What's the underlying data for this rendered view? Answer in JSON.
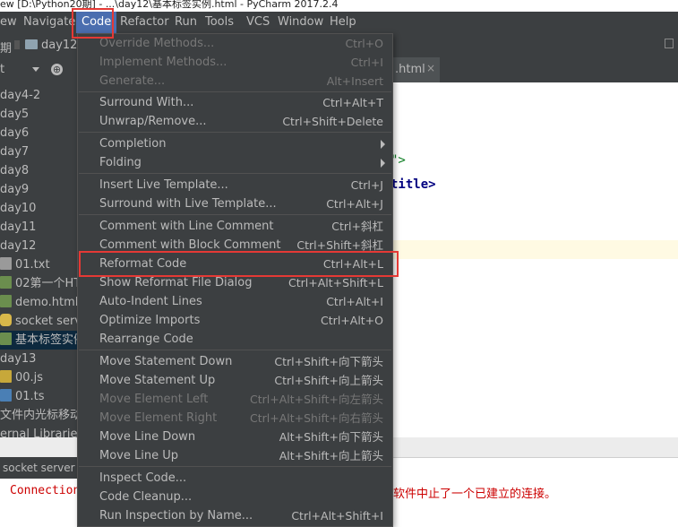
{
  "title_bar": {
    "text": "ew  [D:\\Python20期] - ...\\day12\\基本标签实例.html - PyCharm 2017.2.4"
  },
  "menubar": {
    "items": [
      {
        "label": "ew"
      },
      {
        "label": "Navigate"
      },
      {
        "label": "Code"
      },
      {
        "label": "Refactor"
      },
      {
        "label": "Run"
      },
      {
        "label": "Tools"
      },
      {
        "label": "VCS"
      },
      {
        "label": "Window"
      },
      {
        "label": "Help"
      }
    ]
  },
  "navbar": {
    "crumb1": "期",
    "crumb2": "day12"
  },
  "editor_tab": {
    "label": ".html",
    "close": "×"
  },
  "sidebar": {
    "dropdown_label": "t",
    "rows": [
      {
        "label": "day4-2"
      },
      {
        "label": "day5"
      },
      {
        "label": "day6"
      },
      {
        "label": "day7"
      },
      {
        "label": "day8"
      },
      {
        "label": "day9"
      },
      {
        "label": "day10"
      },
      {
        "label": "day11"
      },
      {
        "label": "day12"
      },
      {
        "label": "01.txt"
      },
      {
        "label": "02第一个HT"
      },
      {
        "label": "demo.html"
      },
      {
        "label": "socket serv"
      },
      {
        "label": "基本标签实例"
      },
      {
        "label": "day13"
      },
      {
        "label": "00.js"
      },
      {
        "label": "01.ts"
      },
      {
        "label": "文件内光标移动"
      },
      {
        "label": "ernal Libraries"
      }
    ]
  },
  "editor": {
    "frag1": "\">",
    "frag2": "title>"
  },
  "bottom_panel": {
    "tab_label": "socket server",
    "console_left": "Connection",
    "console_right": "软件中止了一个已建立的连接。"
  },
  "code_menu": {
    "items": [
      {
        "label": "Override Methods...",
        "shortcut": "Ctrl+O",
        "disabled": true
      },
      {
        "label": "Implement Methods...",
        "shortcut": "Ctrl+I",
        "disabled": true
      },
      {
        "label": "Generate...",
        "shortcut": "Alt+Insert",
        "disabled": true
      },
      {
        "label": "Surround With...",
        "shortcut": "Ctrl+Alt+T"
      },
      {
        "label": "Unwrap/Remove...",
        "shortcut": "Ctrl+Shift+Delete"
      },
      {
        "label": "Completion",
        "shortcut": "",
        "submenu": true
      },
      {
        "label": "Folding",
        "shortcut": "",
        "submenu": true
      },
      {
        "label": "Insert Live Template...",
        "shortcut": "Ctrl+J"
      },
      {
        "label": "Surround with Live Template...",
        "shortcut": "Ctrl+Alt+J"
      },
      {
        "label": "Comment with Line Comment",
        "shortcut": "Ctrl+斜杠"
      },
      {
        "label": "Comment with Block Comment",
        "shortcut": "Ctrl+Shift+斜杠"
      },
      {
        "label": "Reformat Code",
        "shortcut": "Ctrl+Alt+L"
      },
      {
        "label": "Show Reformat File Dialog",
        "shortcut": "Ctrl+Alt+Shift+L"
      },
      {
        "label": "Auto-Indent Lines",
        "shortcut": "Ctrl+Alt+I"
      },
      {
        "label": "Optimize Imports",
        "shortcut": "Ctrl+Alt+O"
      },
      {
        "label": "Rearrange Code",
        "shortcut": ""
      },
      {
        "label": "Move Statement Down",
        "shortcut": "Ctrl+Shift+向下箭头"
      },
      {
        "label": "Move Statement Up",
        "shortcut": "Ctrl+Shift+向上箭头"
      },
      {
        "label": "Move Element Left",
        "shortcut": "Ctrl+Alt+Shift+向左箭头",
        "disabled": true
      },
      {
        "label": "Move Element Right",
        "shortcut": "Ctrl+Alt+Shift+向右箭头",
        "disabled": true
      },
      {
        "label": "Move Line Down",
        "shortcut": "Alt+Shift+向下箭头"
      },
      {
        "label": "Move Line Up",
        "shortcut": "Alt+Shift+向上箭头"
      },
      {
        "label": "Inspect Code...",
        "shortcut": ""
      },
      {
        "label": "Code Cleanup...",
        "shortcut": ""
      },
      {
        "label": "Run Inspection by Name...",
        "shortcut": "Ctrl+Alt+Shift+I"
      }
    ]
  },
  "colors": {
    "menu_bg": "#3c3f41",
    "menu_text": "#bbbbbb",
    "disabled_text": "#777777",
    "active_menu": "#4b6eaf",
    "highlight_box": "#e53935",
    "console_text": "#cc0000",
    "caret_line": "#fffae3"
  }
}
